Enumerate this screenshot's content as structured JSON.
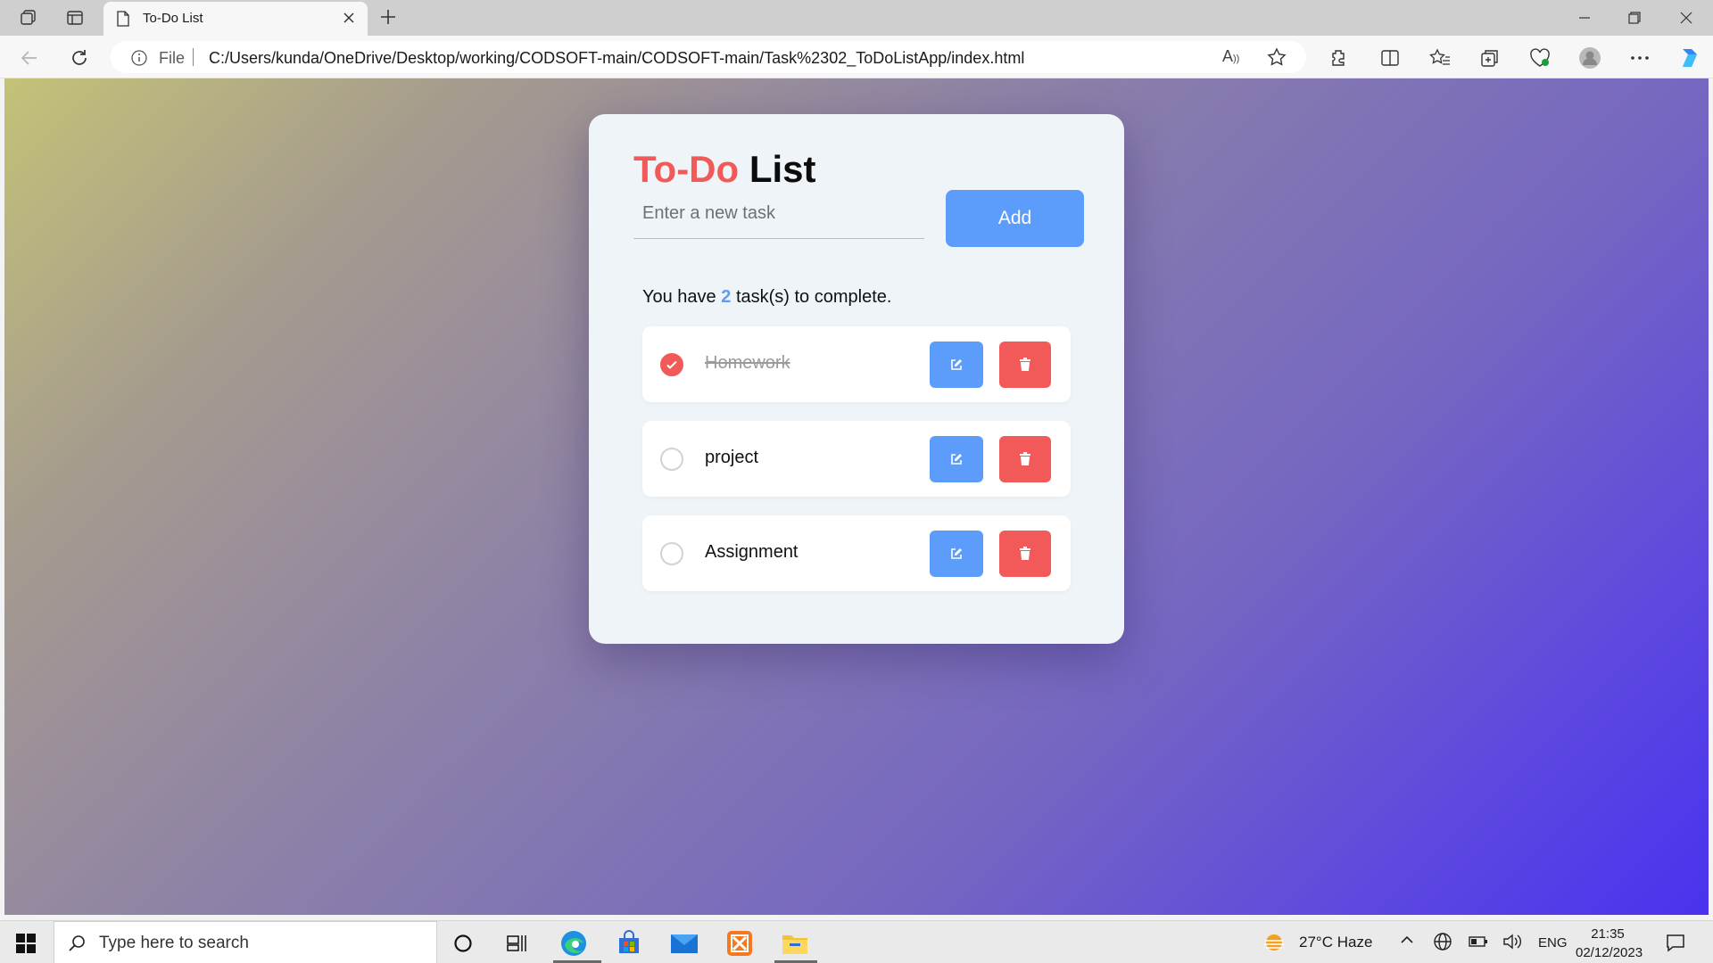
{
  "browser": {
    "tab_title": "To-Do List",
    "address": {
      "scheme_label": "File",
      "url": "C:/Users/kunda/OneDrive/Desktop/working/CODSOFT-main/CODSOFT-main/Task%2302_ToDoListApp/index.html"
    },
    "read_aloud_label": "A"
  },
  "app": {
    "title_accent": "To-Do",
    "title_rest": "List",
    "input_placeholder": "Enter a new task",
    "add_label": "Add",
    "count_prefix": "You have",
    "count_value": "2",
    "count_suffix": "task(s) to complete.",
    "tasks": [
      {
        "text": "Homework",
        "completed": true
      },
      {
        "text": "project",
        "completed": false
      },
      {
        "text": "Assignment",
        "completed": false
      }
    ],
    "colors": {
      "accent_red": "#f25a5a",
      "accent_blue": "#5c9cfa",
      "card_bg": "#eef4f8"
    }
  },
  "taskbar": {
    "search_placeholder": "Type here to search",
    "weather": "27°C  Haze",
    "language": "ENG",
    "time": "21:35",
    "date": "02/12/2023"
  }
}
